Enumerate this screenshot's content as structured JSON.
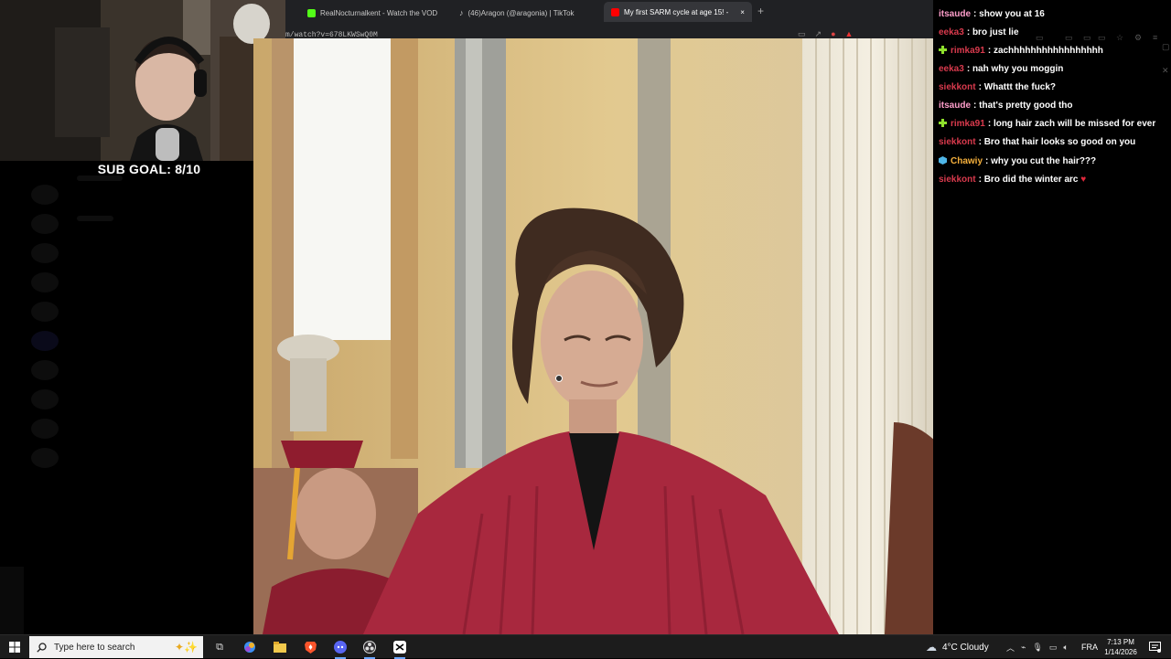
{
  "browser": {
    "tabs": [
      {
        "title": "RealNocturnalkent - Watch the VOD",
        "favicon_color": "#53fc18"
      },
      {
        "title": "(46)Aragon (@aragonia) | TikTok",
        "favicon_color": "#ffffff"
      },
      {
        "title": "My first SARM cycle at age 15! -",
        "favicon_color": "#ff0000"
      }
    ],
    "new_tab": "+",
    "close_tab": "×",
    "url": "m/watch?v=678LKWSwQ0M"
  },
  "overlay": {
    "sub_goal": "SUB GOAL: 8/10"
  },
  "chat": {
    "messages": [
      {
        "user": "itsaude",
        "user_color": "#ff9ecb",
        "text": "show you at 16",
        "badge": ""
      },
      {
        "user": "eeka3",
        "user_color": "#d93a4d",
        "text": "bro just lie",
        "badge": ""
      },
      {
        "user": "rimka91",
        "user_color": "#d93a4d",
        "text": "zachhhhhhhhhhhhhhhhh",
        "badge": "green-plus"
      },
      {
        "user": "eeka3",
        "user_color": "#d93a4d",
        "text": "nah why you moggin",
        "badge": ""
      },
      {
        "user": "siekkont",
        "user_color": "#d93a4d",
        "text": "Whattt the fuck?",
        "badge": ""
      },
      {
        "user": "itsaude",
        "user_color": "#ff9ecb",
        "text": "that's pretty good tho",
        "badge": ""
      },
      {
        "user": "rimka91",
        "user_color": "#d93a4d",
        "text": "long hair zach will be missed for ever",
        "badge": "green-plus"
      },
      {
        "user": "siekkont",
        "user_color": "#d93a4d",
        "text": "Bro that hair looks so good on you",
        "badge": ""
      },
      {
        "user": "Chawiy",
        "user_color": "#f5b03c",
        "text": "why you cut the hair???",
        "badge": "blue-cube"
      },
      {
        "user": "siekkont",
        "user_color": "#d93a4d",
        "text": "Bro did the winter arc",
        "badge": "",
        "emote": "heart"
      }
    ],
    "separator": ":"
  },
  "taskbar": {
    "search_placeholder": "Type here to search",
    "weather": "4°C  Cloudy",
    "language": "FRA",
    "time": "7:13 PM",
    "date": "1/14/2026"
  },
  "colors": {
    "accent": "#6aa6ff",
    "graduation_gown": "#a8283e",
    "chat_bg": "#000000"
  }
}
